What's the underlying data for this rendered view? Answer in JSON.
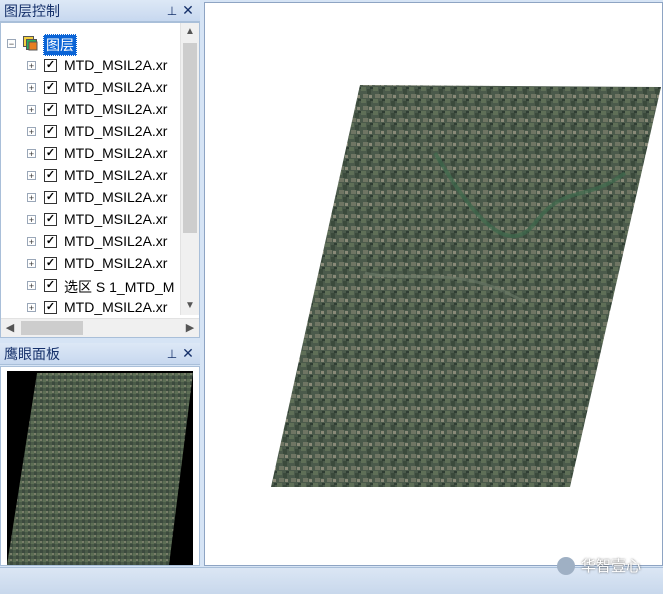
{
  "layer_panel": {
    "title": "图层控制",
    "root_label": "图层",
    "layers": [
      {
        "label": "MTD_MSIL2A.xr",
        "checked": true
      },
      {
        "label": "MTD_MSIL2A.xr",
        "checked": true
      },
      {
        "label": "MTD_MSIL2A.xr",
        "checked": true
      },
      {
        "label": "MTD_MSIL2A.xr",
        "checked": true
      },
      {
        "label": "MTD_MSIL2A.xr",
        "checked": true
      },
      {
        "label": "MTD_MSIL2A.xr",
        "checked": true
      },
      {
        "label": "MTD_MSIL2A.xr",
        "checked": true
      },
      {
        "label": "MTD_MSIL2A.xr",
        "checked": true
      },
      {
        "label": "MTD_MSIL2A.xr",
        "checked": true
      },
      {
        "label": "MTD_MSIL2A.xr",
        "checked": true
      },
      {
        "label": "选区 S 1_MTD_M",
        "checked": true
      },
      {
        "label": "MTD_MSIL2A.xr",
        "checked": true
      }
    ],
    "check_mark": "✓",
    "expand_glyph": "+",
    "collapse_glyph": "−"
  },
  "eagle_panel": {
    "title": "鹰眼面板"
  },
  "panel_controls": {
    "pin": "📌",
    "close": "✕"
  },
  "scroll_glyphs": {
    "up": "▲",
    "down": "▼",
    "left": "◀",
    "right": "▶"
  },
  "watermark": "华智壹心",
  "colors": {
    "accent": "#15306a",
    "selection": "#0a64d6"
  }
}
